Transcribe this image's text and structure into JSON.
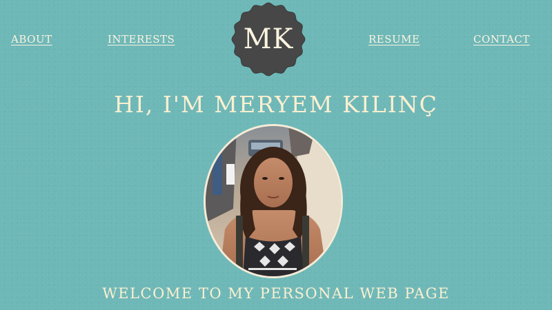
{
  "nav": {
    "about": "About",
    "interests": "Interests",
    "resume": "Resume",
    "contact": "Contact"
  },
  "logo": {
    "initials": "MK"
  },
  "hero": {
    "title": "Hi, I'm Meryem Kılınç",
    "subtitle": "Welcome to my personal web page"
  },
  "colors": {
    "background": "#6fb8b8",
    "text": "#fbf0d0",
    "logo_fill": "#474747"
  },
  "portrait": {
    "icon": "profile-photo"
  }
}
